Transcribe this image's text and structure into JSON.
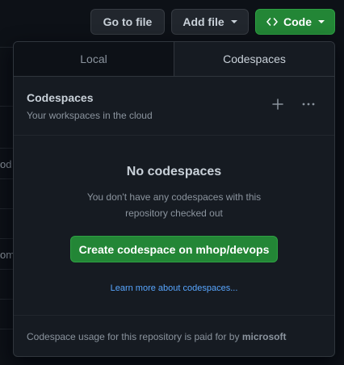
{
  "background": {
    "fragments": [
      "od",
      "om"
    ]
  },
  "toolbar": {
    "go_to_file": "Go to file",
    "add_file": "Add file",
    "code": "Code"
  },
  "dropdown": {
    "tabs": [
      "Local",
      "Codespaces"
    ],
    "active_tab": "Codespaces",
    "section": {
      "title": "Codespaces",
      "subtitle": "Your workspaces in the cloud"
    },
    "empty_state": {
      "title": "No codespaces",
      "description": "You don't have any codespaces with this repository checked out",
      "create_button": "Create codespace on mhop/devops",
      "learn_more": "Learn more about codespaces..."
    },
    "footer": {
      "text": "Codespace usage for this repository is paid for by",
      "payer": "microsoft"
    }
  },
  "colors": {
    "primary_green": "#238636",
    "link_blue": "#58a6ff",
    "panel_bg": "#161b22",
    "page_bg": "#0d1117"
  },
  "icons": {
    "code": "code-brackets-icon",
    "add": "plus-icon",
    "more": "kebab-horizontal-icon",
    "dropdown": "caret-down-icon"
  }
}
